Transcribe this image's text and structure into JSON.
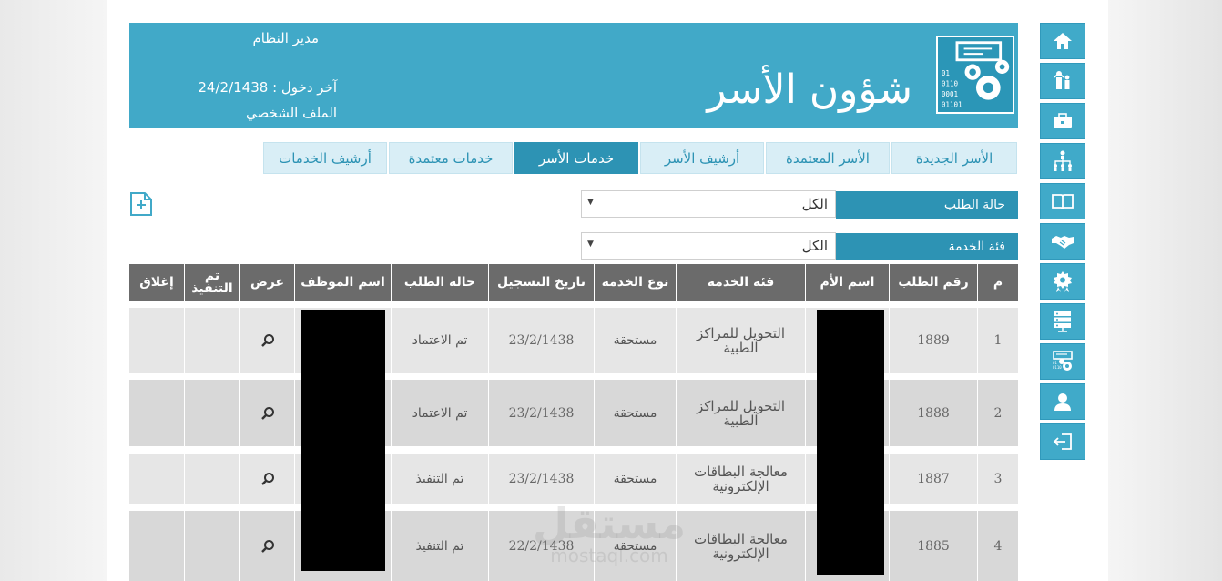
{
  "header": {
    "title": "شؤون الأسر",
    "role": "مدير النظام",
    "last_login": "آخر دخول : 24/2/1438",
    "profile_link": "الملف الشخصي"
  },
  "tabs": [
    {
      "label": "الأسر الجديدة",
      "active": false
    },
    {
      "label": "الأسر المعتمدة",
      "active": false
    },
    {
      "label": "أرشيف الأسر",
      "active": false
    },
    {
      "label": "خدمات الأسر",
      "active": true
    },
    {
      "label": "خدمات معتمدة",
      "active": false
    },
    {
      "label": "أرشيف الخدمات",
      "active": false
    }
  ],
  "filters": {
    "status": {
      "label": "حالة الطلب",
      "value": "الكل"
    },
    "category": {
      "label": "فئة الخدمة",
      "value": "الكل"
    }
  },
  "table": {
    "columns": [
      "م",
      "رقم الطلب",
      "اسم الأم",
      "فئة الخدمة",
      "نوع الخدمة",
      "تاريخ التسجيل",
      "حالة الطلب",
      "اسم الموظف",
      "عرض",
      "تم التنفيذ",
      "إغلاق"
    ],
    "rows": [
      {
        "index": "1",
        "request_no": "1889",
        "service_category": "التحويل للمراكز الطبية",
        "service_type": "مستحقة",
        "date": "23/2/1438",
        "status": "تم الاعتماد"
      },
      {
        "index": "2",
        "request_no": "1888",
        "service_category": "التحويل للمراكز الطبية",
        "service_type": "مستحقة",
        "date": "23/2/1438",
        "status": "تم الاعتماد"
      },
      {
        "index": "3",
        "request_no": "1887",
        "service_category": "معالجة البطاقات الإلكترونية",
        "service_type": "مستحقة",
        "date": "23/2/1438",
        "status": "تم التنفيذ"
      },
      {
        "index": "4",
        "request_no": "1885",
        "service_category": "معالجة البطاقات الإلكترونية",
        "service_type": "مستحقة",
        "date": "22/2/1438",
        "status": "تم التنفيذ"
      }
    ]
  },
  "watermark": {
    "text": "مستقل",
    "sub": "mostaql.com"
  },
  "sidebar": {
    "icons": [
      "home-icon",
      "family-icon",
      "briefcase-icon",
      "org-chart-icon",
      "book-icon",
      "handshake-icon",
      "badge-icon",
      "server-icon",
      "report-settings-icon",
      "user-icon",
      "logout-icon"
    ]
  },
  "colors": {
    "primary": "#41a9c8",
    "dark_primary": "#2d93b4",
    "header_gray": "#6b6b6b"
  }
}
